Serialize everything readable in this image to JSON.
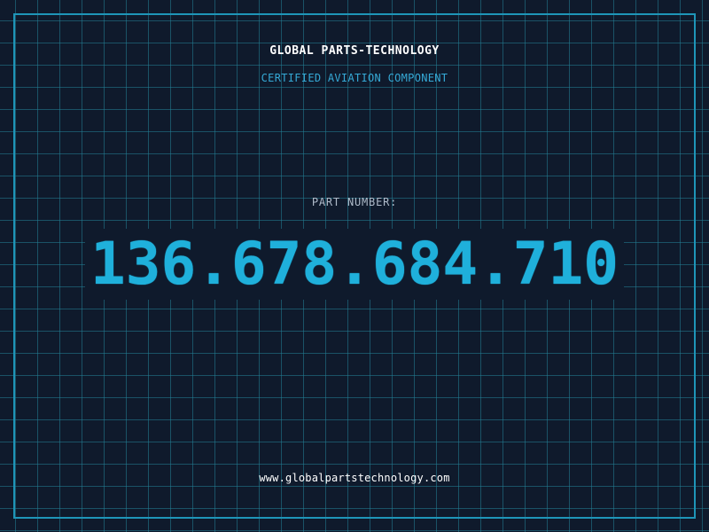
{
  "header": {
    "brand": "GLOBAL PARTS-TECHNOLOGY",
    "subtitle": "CERTIFIED AVIATION COMPONENT"
  },
  "part": {
    "label": "PART NUMBER:",
    "number": "136.678.684.710"
  },
  "footer": {
    "website": "www.globalpartstechnology.com"
  },
  "colors": {
    "background": "#0f1a2c",
    "grid": "#228096",
    "frame": "#1e95b8",
    "accent": "#1fb0db",
    "subtitle": "#35a9d6",
    "label": "#b0bccb",
    "text": "#ffffff"
  }
}
